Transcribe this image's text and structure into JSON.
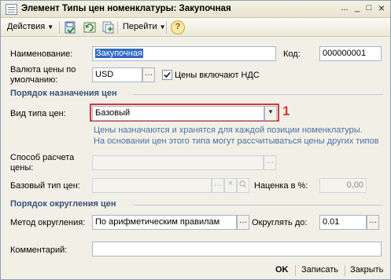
{
  "window": {
    "title": "Элемент Типы цен номенклатуры: Закупочная",
    "controls": {
      "menu": "...",
      "minimize": "_",
      "maximize": "□",
      "close": "×"
    }
  },
  "toolbar": {
    "actions_label": "Действия",
    "goto_label": "Перейти",
    "help_icon": "?"
  },
  "form": {
    "name_label": "Наименование:",
    "name_value": "Закупочная",
    "code_label": "Код:",
    "code_value": "000000001",
    "currency_label_line1": "Валюта цены по",
    "currency_label_line2": "умолчанию:",
    "currency_value": "USD",
    "vat_checkbox_label": "Цены включают НДС",
    "vat_checked": true,
    "section_purpose": "Порядок назначения цен",
    "price_type_label": "Вид типа цен:",
    "price_type_value": "Базовый",
    "annotation_number": "1",
    "hint_line1": "Цены назначаются и хранятся для каждой позиции номенклатуры.",
    "hint_line2": "На основании цен этого типа могут рассчитываться цены других типов",
    "calc_method_label_line1": "Способ расчета",
    "calc_method_label_line2": "цены:",
    "calc_method_value": "",
    "base_type_label": "Базовый тип цен:",
    "base_type_value": "",
    "markup_label": "Наценка в %:",
    "markup_value": "0,00",
    "section_rounding": "Порядок округления цен",
    "rounding_method_label": "Метод округления:",
    "rounding_method_value": "По арифметическим правилам",
    "round_to_label": "Округлять до:",
    "round_to_value": "0.01",
    "comment_label": "Комментарий:",
    "comment_value": ""
  },
  "footer": {
    "ok_label": "OK",
    "save_label": "Записать",
    "close_label": "Закрыть"
  },
  "colors": {
    "section_title": "#39527a",
    "hint_text": "#4a6fa7",
    "selection": "#3169c6",
    "annotation_red": "#d1373b"
  }
}
